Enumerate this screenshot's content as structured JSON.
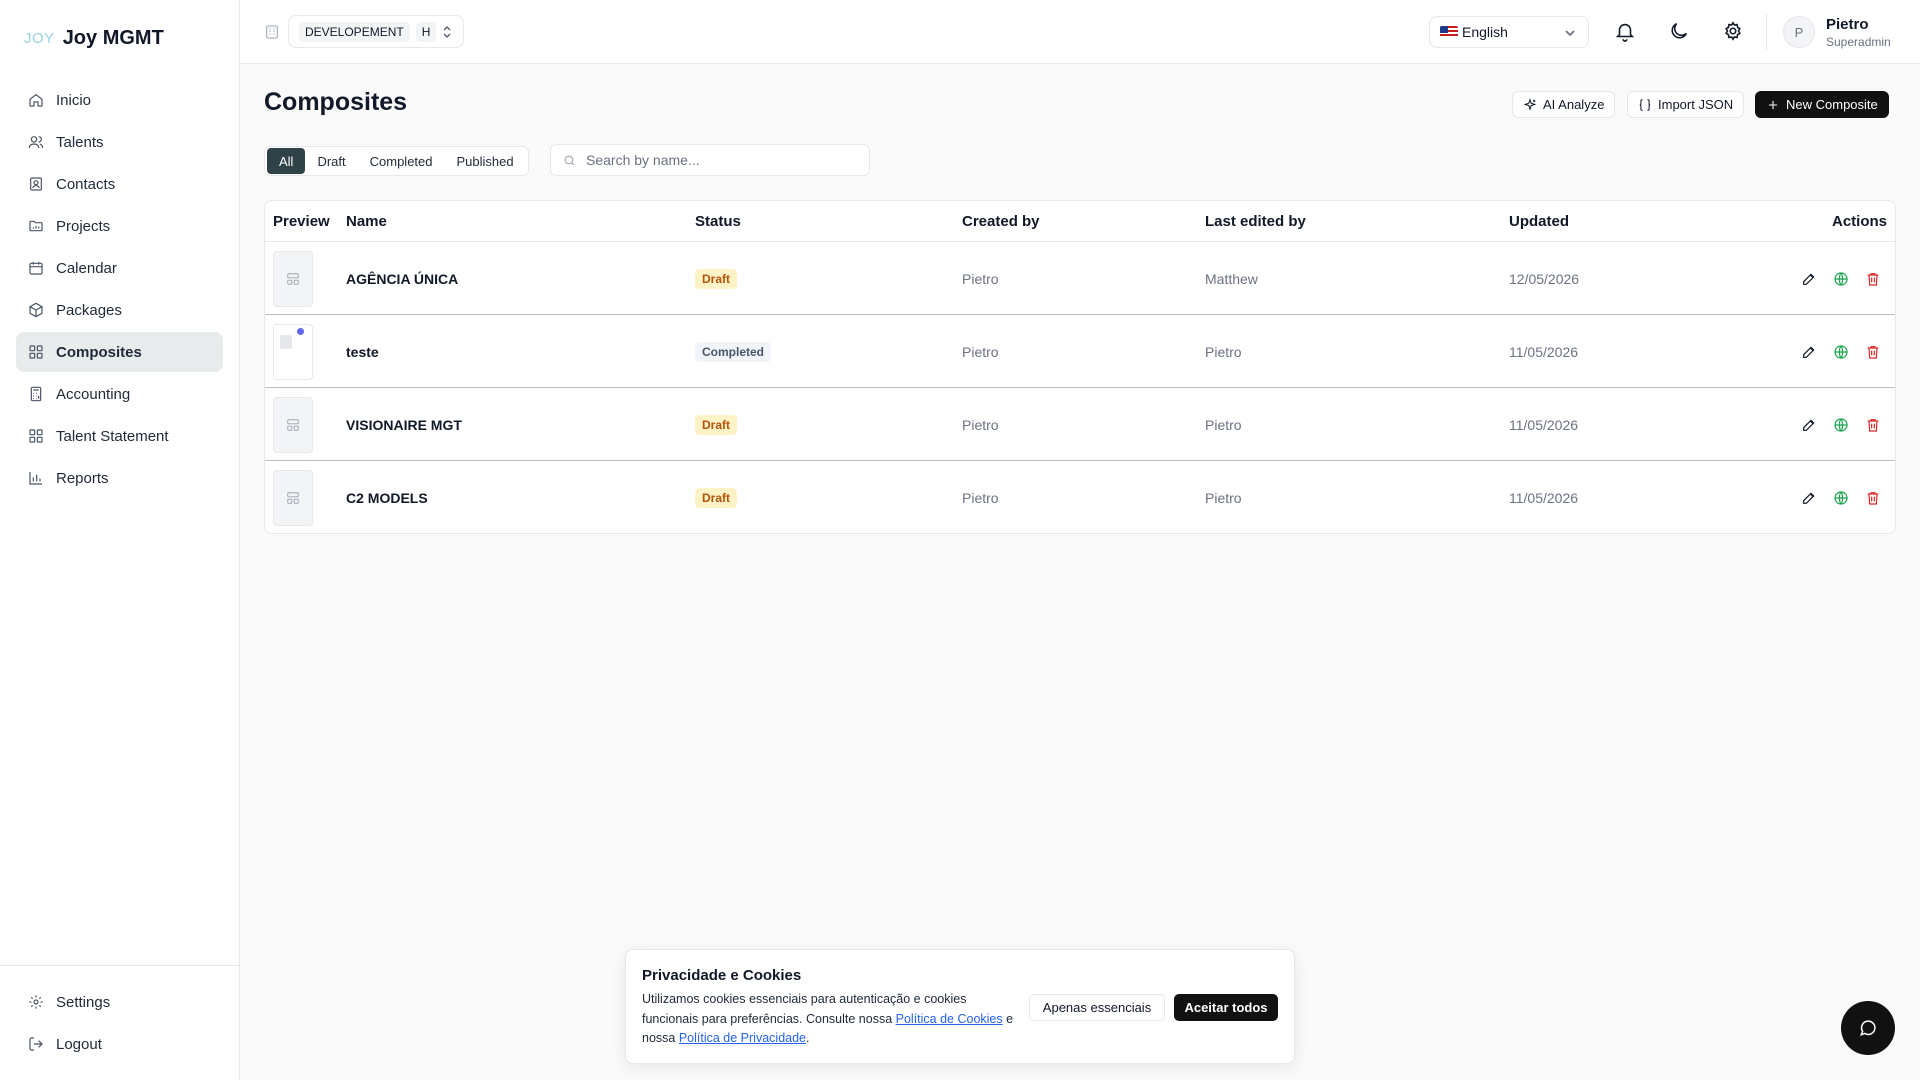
{
  "brand": {
    "logo": "JOY",
    "name": "Joy MGMT"
  },
  "sidebar": {
    "items": [
      {
        "label": "Inicio",
        "icon": "home-icon"
      },
      {
        "label": "Talents",
        "icon": "users-icon"
      },
      {
        "label": "Contacts",
        "icon": "contact-icon"
      },
      {
        "label": "Projects",
        "icon": "folder-icon"
      },
      {
        "label": "Calendar",
        "icon": "calendar-icon"
      },
      {
        "label": "Packages",
        "icon": "package-icon"
      },
      {
        "label": "Composites",
        "icon": "grid-icon",
        "active": true
      },
      {
        "label": "Accounting",
        "icon": "calculator-icon"
      },
      {
        "label": "Talent Statement",
        "icon": "grid-icon"
      },
      {
        "label": "Reports",
        "icon": "bar-chart-icon"
      }
    ],
    "footer": [
      {
        "label": "Settings",
        "icon": "gear-icon"
      },
      {
        "label": "Logout",
        "icon": "logout-icon"
      }
    ]
  },
  "header": {
    "environment": "DEVELOPEMENT",
    "environment_short": "H",
    "language": "English",
    "user": {
      "initial": "P",
      "name": "Pietro",
      "role": "Superadmin"
    }
  },
  "main": {
    "title": "Composites",
    "actions": {
      "ai_analyze": "AI Analyze",
      "import_json": "Import JSON",
      "new_composite": "New Composite"
    },
    "filters": [
      "All",
      "Draft",
      "Completed",
      "Published"
    ],
    "active_filter": "All",
    "search": {
      "placeholder": "Search by name...",
      "value": ""
    },
    "table": {
      "headers": [
        "Preview",
        "Name",
        "Status",
        "Created by",
        "Last edited by",
        "Updated",
        "Actions"
      ],
      "rows": [
        {
          "name": "AGÊNCIA ÚNICA",
          "status": "Draft",
          "created_by": "Pietro",
          "last_edited_by": "Matthew",
          "updated": "12/05/2026"
        },
        {
          "name": "teste",
          "status": "Completed",
          "created_by": "Pietro",
          "last_edited_by": "Pietro",
          "updated": "11/05/2026"
        },
        {
          "name": "VISIONAIRE MGT",
          "status": "Draft",
          "created_by": "Pietro",
          "last_edited_by": "Pietro",
          "updated": "11/05/2026"
        },
        {
          "name": "C2 MODELS",
          "status": "Draft",
          "created_by": "Pietro",
          "last_edited_by": "Pietro",
          "updated": "11/05/2026"
        }
      ]
    }
  },
  "cookie_banner": {
    "title": "Privacidade e Cookies",
    "text_1": "Utilizamos cookies essenciais para autenticação e cookies funcionais para preferências. Consulte nossa ",
    "link_cookies": "Política de Cookies",
    "text_2": " e nossa ",
    "link_privacy": "Política de Privacidade",
    "text_3": ".",
    "btn_essential": "Apenas essenciais",
    "btn_accept": "Aceitar todos"
  },
  "colors": {
    "accent": "#2f4247",
    "draft": "#b45309",
    "publish": "#16a34a",
    "delete": "#dc2626"
  }
}
